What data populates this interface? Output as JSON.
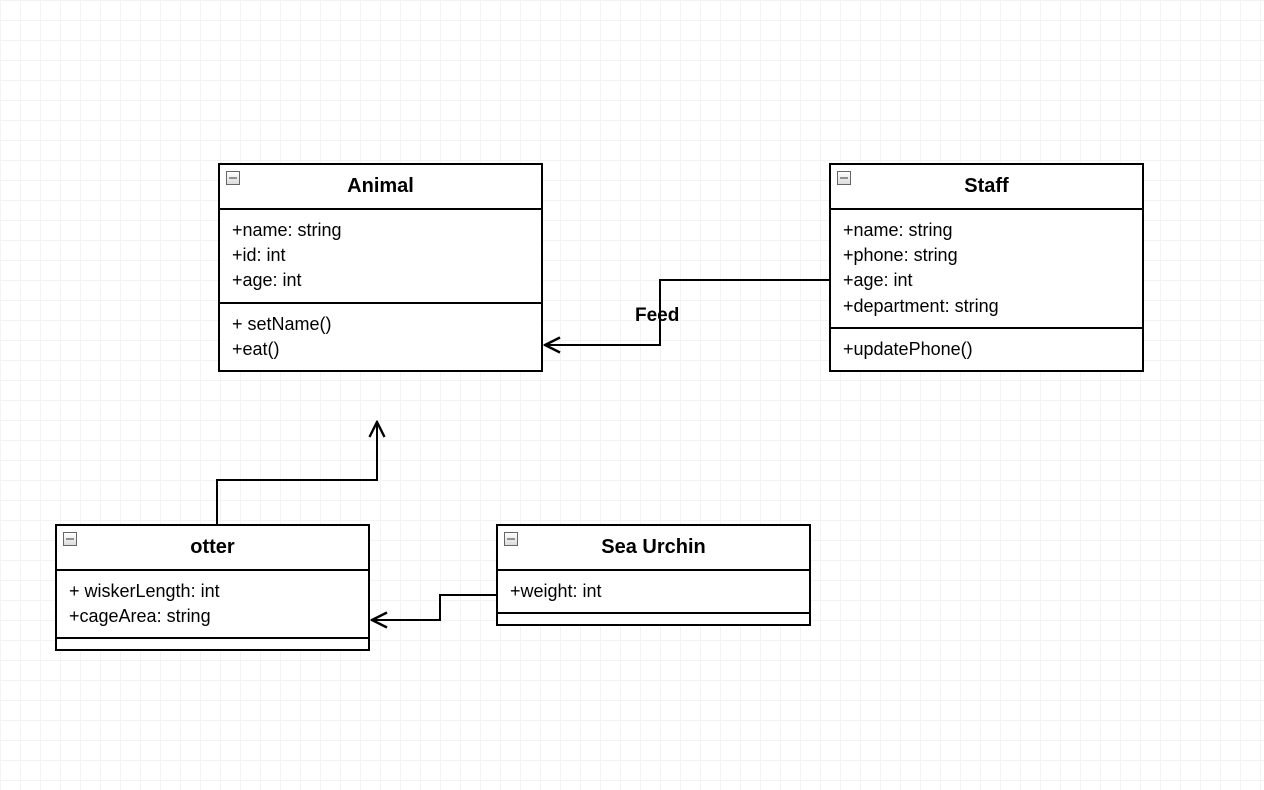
{
  "diagram": {
    "classes": {
      "animal": {
        "name": "Animal",
        "attrs": [
          "+name: string",
          "+id: int",
          "+age: int"
        ],
        "methods": [
          "+ setName()",
          "+eat()"
        ]
      },
      "staff": {
        "name": "Staff",
        "attrs": [
          "+name: string",
          "+phone: string",
          "+age: int",
          "+department: string"
        ],
        "methods": [
          "+updatePhone()"
        ]
      },
      "otter": {
        "name": "otter",
        "attrs": [
          "+ wiskerLength: int",
          "+cageArea: string"
        ],
        "methods": []
      },
      "seaUrchin": {
        "name": "Sea Urchin",
        "attrs": [
          "+weight: int"
        ],
        "methods": []
      }
    },
    "relationships": {
      "feed": {
        "label": "Feed"
      }
    }
  }
}
